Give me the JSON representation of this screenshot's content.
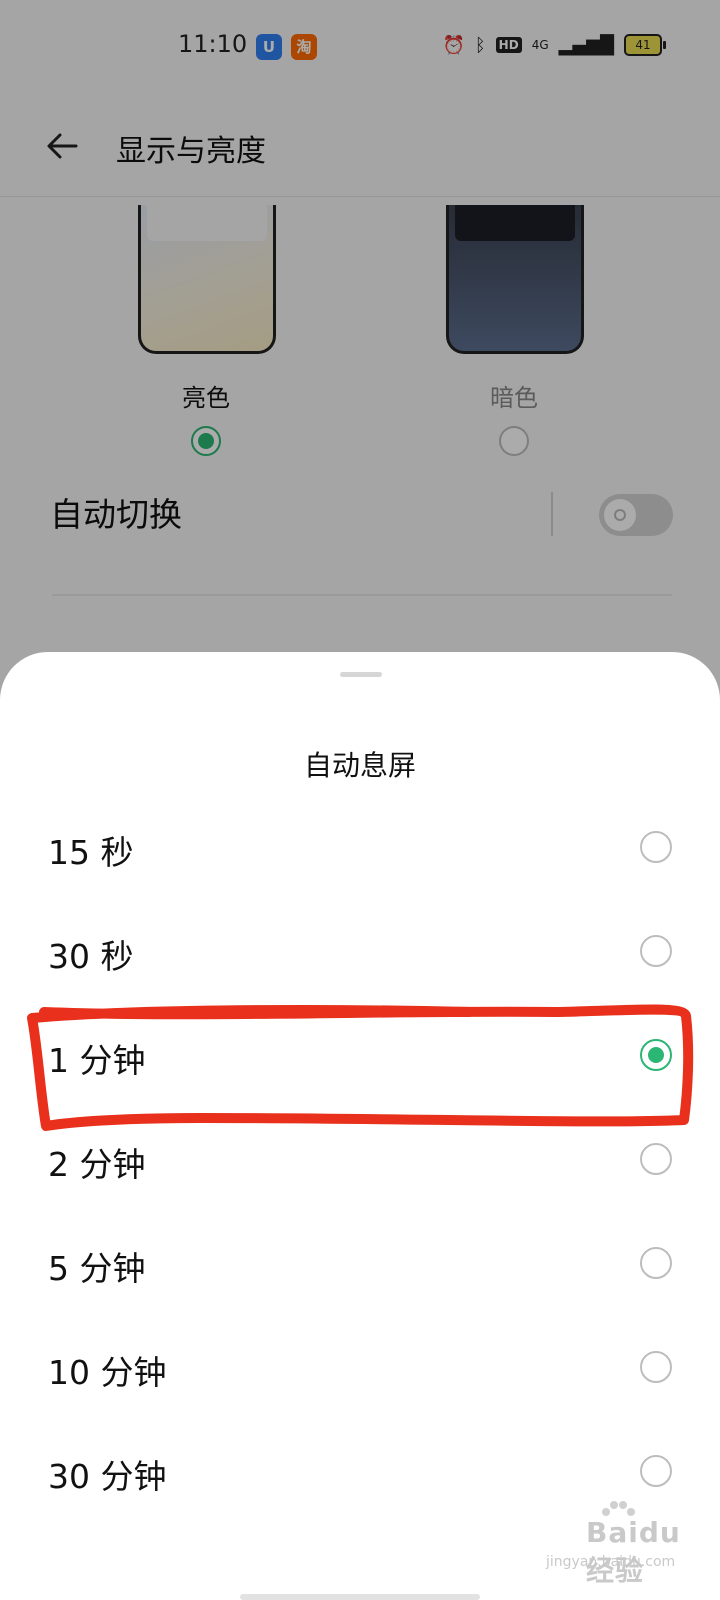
{
  "status_bar": {
    "time": "11:10",
    "app_icons": [
      "U",
      "淘"
    ],
    "hd": "HD",
    "network": "4G",
    "battery": "41"
  },
  "header": {
    "title": "显示与亮度"
  },
  "theme": {
    "light_label": "亮色",
    "dark_label": "暗色",
    "selected": "light"
  },
  "auto_switch": {
    "label": "自动切换",
    "on": false
  },
  "sheet": {
    "title": "自动息屏",
    "options": [
      {
        "label": "15 秒",
        "selected": false
      },
      {
        "label": "30 秒",
        "selected": false
      },
      {
        "label": "1 分钟",
        "selected": true
      },
      {
        "label": "2 分钟",
        "selected": false
      },
      {
        "label": "5 分钟",
        "selected": false
      },
      {
        "label": "10 分钟",
        "selected": false
      },
      {
        "label": "30 分钟",
        "selected": false
      }
    ]
  },
  "watermark": {
    "main": "Baidu经验",
    "sub": "jingyan.baidu.com"
  },
  "colors": {
    "accent": "#2bb673",
    "annotation": "#e8301c"
  }
}
